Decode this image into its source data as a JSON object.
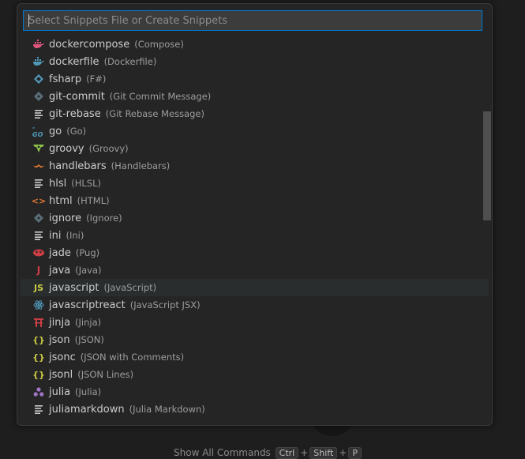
{
  "quick_pick": {
    "placeholder": "Select Snippets File or Create Snippets",
    "value": ""
  },
  "items": [
    {
      "label": "dockercompose",
      "desc": "(Compose)",
      "icon": "docker-compose-icon",
      "color": "#e0567d"
    },
    {
      "label": "dockerfile",
      "desc": "(Dockerfile)",
      "icon": "docker-icon",
      "color": "#519aba"
    },
    {
      "label": "fsharp",
      "desc": "(F#)",
      "icon": "fsharp-icon",
      "color": "#519aba"
    },
    {
      "label": "git-commit",
      "desc": "(Git Commit Message)",
      "icon": "git-icon",
      "color": "#41535b"
    },
    {
      "label": "git-rebase",
      "desc": "(Git Rebase Message)",
      "icon": "lines-icon",
      "color": "#cccccc"
    },
    {
      "label": "go",
      "desc": "(Go)",
      "icon": "go-icon",
      "color": "#519aba",
      "glyph": "-GO"
    },
    {
      "label": "groovy",
      "desc": "(Groovy)",
      "icon": "groovy-icon",
      "color": "#8dc149"
    },
    {
      "label": "handlebars",
      "desc": "(Handlebars)",
      "icon": "handlebars-icon",
      "color": "#e37933"
    },
    {
      "label": "hlsl",
      "desc": "(HLSL)",
      "icon": "lines-icon",
      "color": "#cccccc"
    },
    {
      "label": "html",
      "desc": "(HTML)",
      "icon": "html-icon",
      "color": "#e37933",
      "glyph": "<>"
    },
    {
      "label": "ignore",
      "desc": "(Ignore)",
      "icon": "git-icon",
      "color": "#41535b"
    },
    {
      "label": "ini",
      "desc": "(Ini)",
      "icon": "lines-icon",
      "color": "#cccccc"
    },
    {
      "label": "jade",
      "desc": "(Pug)",
      "icon": "pug-icon",
      "color": "#cc3e44"
    },
    {
      "label": "java",
      "desc": "(Java)",
      "icon": "java-icon",
      "color": "#cc3e44",
      "glyph": "J"
    },
    {
      "label": "javascript",
      "desc": "(JavaScript)",
      "icon": "javascript-icon",
      "color": "#cbcb41",
      "glyph": "JS"
    },
    {
      "label": "javascriptreact",
      "desc": "(JavaScript JSX)",
      "icon": "react-icon",
      "color": "#519aba"
    },
    {
      "label": "jinja",
      "desc": "(Jinja)",
      "icon": "jinja-icon",
      "color": "#cc3e44"
    },
    {
      "label": "json",
      "desc": "(JSON)",
      "icon": "json-icon",
      "color": "#cbcb41",
      "glyph": "{}"
    },
    {
      "label": "jsonc",
      "desc": "(JSON with Comments)",
      "icon": "json-icon",
      "color": "#cbcb41",
      "glyph": "{}"
    },
    {
      "label": "jsonl",
      "desc": "(JSON Lines)",
      "icon": "json-icon",
      "color": "#cbcb41",
      "glyph": "{}"
    },
    {
      "label": "julia",
      "desc": "(Julia)",
      "icon": "julia-icon",
      "color": "#a074c4"
    },
    {
      "label": "juliamarkdown",
      "desc": "(Julia Markdown)",
      "icon": "lines-icon",
      "color": "#cccccc"
    }
  ],
  "active_index": 14,
  "footer_hint": {
    "text": "Show All Commands",
    "keys": [
      "Ctrl",
      "Shift",
      "P"
    ]
  }
}
